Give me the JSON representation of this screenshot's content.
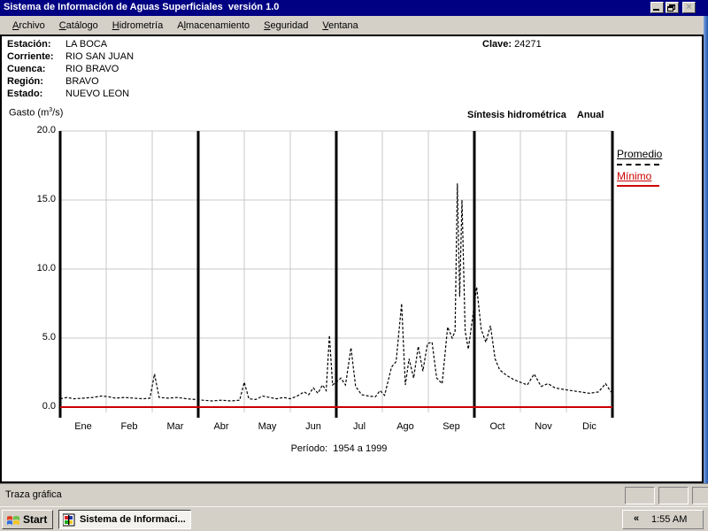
{
  "window": {
    "title": "Sistema de Información de Aguas Superficiales  versión 1.0",
    "buttons": {
      "minimize": "minimize",
      "restore": "restore",
      "close": "×"
    }
  },
  "menu": {
    "items": [
      {
        "pre": "",
        "key": "A",
        "rest": "rchivo"
      },
      {
        "pre": "",
        "key": "C",
        "rest": "atálogo"
      },
      {
        "pre": "",
        "key": "H",
        "rest": "idrometría"
      },
      {
        "pre": "A",
        "key": "l",
        "rest": "macenamiento"
      },
      {
        "pre": "",
        "key": "S",
        "rest": "eguridad"
      },
      {
        "pre": "",
        "key": "V",
        "rest": "entana"
      }
    ]
  },
  "station": {
    "rows": [
      {
        "label": "Estación:",
        "value": "LA BOCA"
      },
      {
        "label": "Corriente:",
        "value": "RIO SAN JUAN"
      },
      {
        "label": "Cuenca:",
        "value": "RIO BRAVO"
      },
      {
        "label": "Región:",
        "value": "BRAVO"
      },
      {
        "label": "Estado:",
        "value": "NUEVO LEON"
      }
    ],
    "clave_label": "Clave:",
    "clave_value": "24271"
  },
  "chart_header": {
    "gasto_prefix": "Gasto (m",
    "gasto_sup": "3",
    "gasto_suffix": "/s)",
    "sintesis_title": "Síntesis hidrométrica",
    "sintesis_mode": "Anual"
  },
  "legend": {
    "promedio_label": "Promedio",
    "minimo_label": "Mínimo",
    "promedio_color": "#000000",
    "minimo_color": "#cc0000"
  },
  "chart_data": {
    "type": "line",
    "title": "Síntesis hidrométrica Anual",
    "ylabel": "Gasto (m3/s)",
    "xlabel": "",
    "categories": [
      "Ene",
      "Feb",
      "Mar",
      "Abr",
      "May",
      "Jun",
      "Jul",
      "Ago",
      "Sep",
      "Oct",
      "Nov",
      "Dic"
    ],
    "yticks": [
      0,
      5,
      10,
      15,
      20
    ],
    "ytick_labels": [
      "0.0",
      "5.0",
      "10.0",
      "15.0",
      "20.0"
    ],
    "ylim": [
      0,
      20
    ],
    "xlim_months": [
      0,
      12
    ],
    "grid": true,
    "quarter_divider_months": [
      0,
      3,
      6,
      9,
      12
    ],
    "period_note": "Período:  1954 a 1999",
    "legend_position": "right",
    "series": [
      {
        "name": "Promedio",
        "style": "dashed",
        "color": "#000000",
        "points": [
          [
            0.0,
            0.6
          ],
          [
            0.15,
            0.7
          ],
          [
            0.3,
            0.6
          ],
          [
            0.5,
            0.65
          ],
          [
            0.7,
            0.7
          ],
          [
            0.9,
            0.8
          ],
          [
            1.05,
            0.75
          ],
          [
            1.2,
            0.65
          ],
          [
            1.4,
            0.7
          ],
          [
            1.6,
            0.65
          ],
          [
            1.8,
            0.6
          ],
          [
            1.95,
            0.65
          ],
          [
            2.05,
            2.4
          ],
          [
            2.15,
            0.7
          ],
          [
            2.35,
            0.65
          ],
          [
            2.55,
            0.7
          ],
          [
            2.75,
            0.6
          ],
          [
            2.95,
            0.55
          ],
          [
            3.1,
            0.5
          ],
          [
            3.3,
            0.45
          ],
          [
            3.5,
            0.5
          ],
          [
            3.7,
            0.45
          ],
          [
            3.9,
            0.5
          ],
          [
            4.0,
            1.8
          ],
          [
            4.1,
            0.6
          ],
          [
            4.25,
            0.55
          ],
          [
            4.4,
            0.8
          ],
          [
            4.55,
            0.7
          ],
          [
            4.7,
            0.6
          ],
          [
            4.85,
            0.7
          ],
          [
            5.0,
            0.6
          ],
          [
            5.15,
            0.8
          ],
          [
            5.3,
            1.1
          ],
          [
            5.4,
            0.9
          ],
          [
            5.5,
            1.4
          ],
          [
            5.6,
            1.0
          ],
          [
            5.7,
            1.6
          ],
          [
            5.78,
            1.2
          ],
          [
            5.85,
            5.2
          ],
          [
            5.92,
            1.6
          ],
          [
            6.0,
            1.8
          ],
          [
            6.1,
            2.1
          ],
          [
            6.2,
            1.6
          ],
          [
            6.32,
            4.3
          ],
          [
            6.42,
            1.5
          ],
          [
            6.55,
            0.9
          ],
          [
            6.7,
            0.8
          ],
          [
            6.85,
            0.75
          ],
          [
            6.95,
            1.2
          ],
          [
            7.05,
            0.85
          ],
          [
            7.2,
            2.9
          ],
          [
            7.3,
            3.3
          ],
          [
            7.42,
            7.5
          ],
          [
            7.5,
            1.6
          ],
          [
            7.58,
            3.5
          ],
          [
            7.68,
            2.1
          ],
          [
            7.78,
            4.4
          ],
          [
            7.88,
            2.6
          ],
          [
            7.98,
            4.6
          ],
          [
            8.08,
            4.7
          ],
          [
            8.18,
            2.1
          ],
          [
            8.3,
            1.7
          ],
          [
            8.42,
            5.8
          ],
          [
            8.52,
            5.0
          ],
          [
            8.58,
            5.5
          ],
          [
            8.63,
            16.2
          ],
          [
            8.68,
            8.0
          ],
          [
            8.73,
            15.0
          ],
          [
            8.8,
            5.5
          ],
          [
            8.87,
            4.2
          ],
          [
            8.95,
            6.2
          ],
          [
            9.05,
            8.7
          ],
          [
            9.15,
            5.6
          ],
          [
            9.25,
            4.7
          ],
          [
            9.35,
            5.9
          ],
          [
            9.45,
            3.5
          ],
          [
            9.55,
            2.7
          ],
          [
            9.7,
            2.3
          ],
          [
            9.85,
            2.0
          ],
          [
            10.0,
            1.8
          ],
          [
            10.15,
            1.6
          ],
          [
            10.3,
            2.4
          ],
          [
            10.45,
            1.5
          ],
          [
            10.6,
            1.7
          ],
          [
            10.75,
            1.4
          ],
          [
            10.9,
            1.3
          ],
          [
            11.1,
            1.2
          ],
          [
            11.3,
            1.1
          ],
          [
            11.5,
            1.0
          ],
          [
            11.7,
            1.1
          ],
          [
            11.85,
            1.7
          ],
          [
            11.95,
            1.2
          ],
          [
            12.0,
            1.0
          ]
        ]
      },
      {
        "name": "Mínimo",
        "style": "solid",
        "color": "#cc0000",
        "points": [
          [
            0,
            0
          ],
          [
            12,
            0
          ]
        ]
      }
    ]
  },
  "statusbar": {
    "text": "Traza gráfica"
  },
  "taskbar": {
    "start_label": "Start",
    "app_button_label": "Sistema de Informaci...",
    "tray_chevron": "«",
    "clock": "1:55 AM"
  }
}
